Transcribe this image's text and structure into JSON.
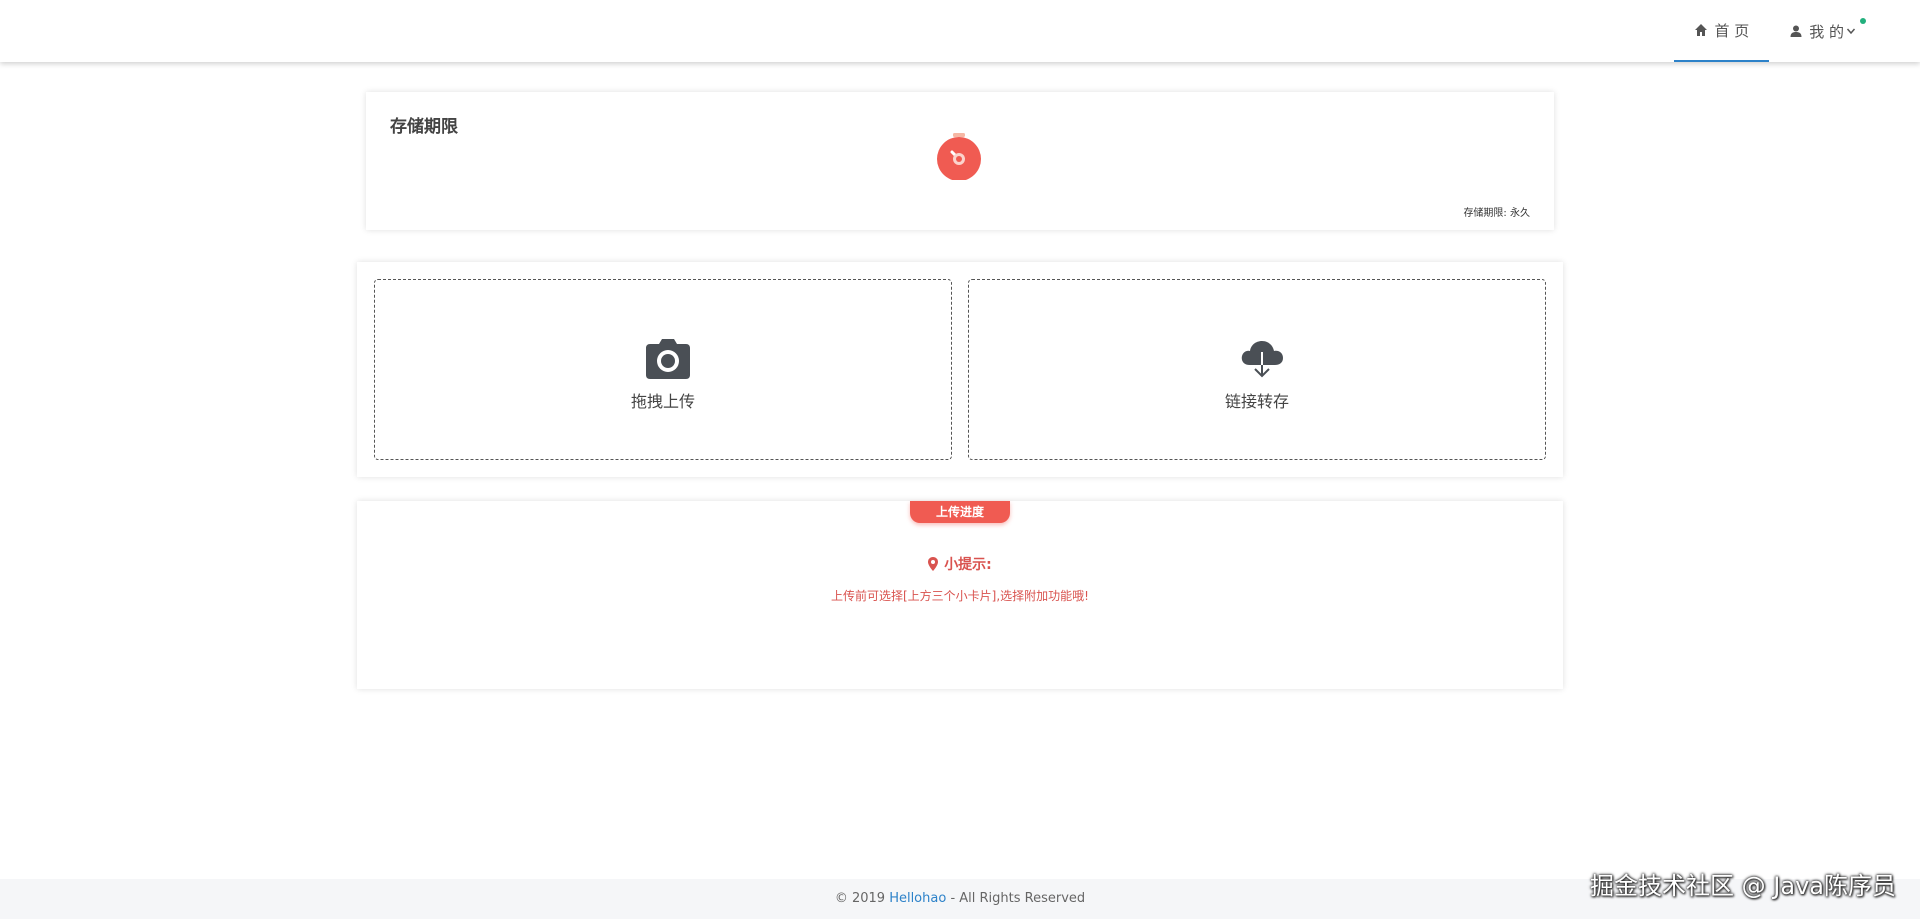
{
  "header": {
    "nav": [
      {
        "label": "首 页",
        "icon": "home-icon",
        "active": true
      },
      {
        "label": "我 的",
        "icon": "user-icon",
        "active": false
      }
    ]
  },
  "storage": {
    "title": "存储期限",
    "status_label": "存储期限:",
    "status_value": "永久"
  },
  "upload": {
    "drag_label": "拖拽上传",
    "link_label": "链接转存"
  },
  "progress": {
    "badge": "上传进度",
    "tip_title": "小提示:",
    "tip_text": "上传前可选择[上方三个小卡片],选择附加功能哦!"
  },
  "footer": {
    "prefix": "© 2019 ",
    "brand": "Hellohao",
    "suffix": " - All Rights Reserved"
  },
  "watermark": "掘金技术社区 @ Java陈序员",
  "colors": {
    "accent": "#f05b52",
    "link": "#2d82c9",
    "tip": "#d9534f",
    "notify_dot": "#22b07d"
  }
}
